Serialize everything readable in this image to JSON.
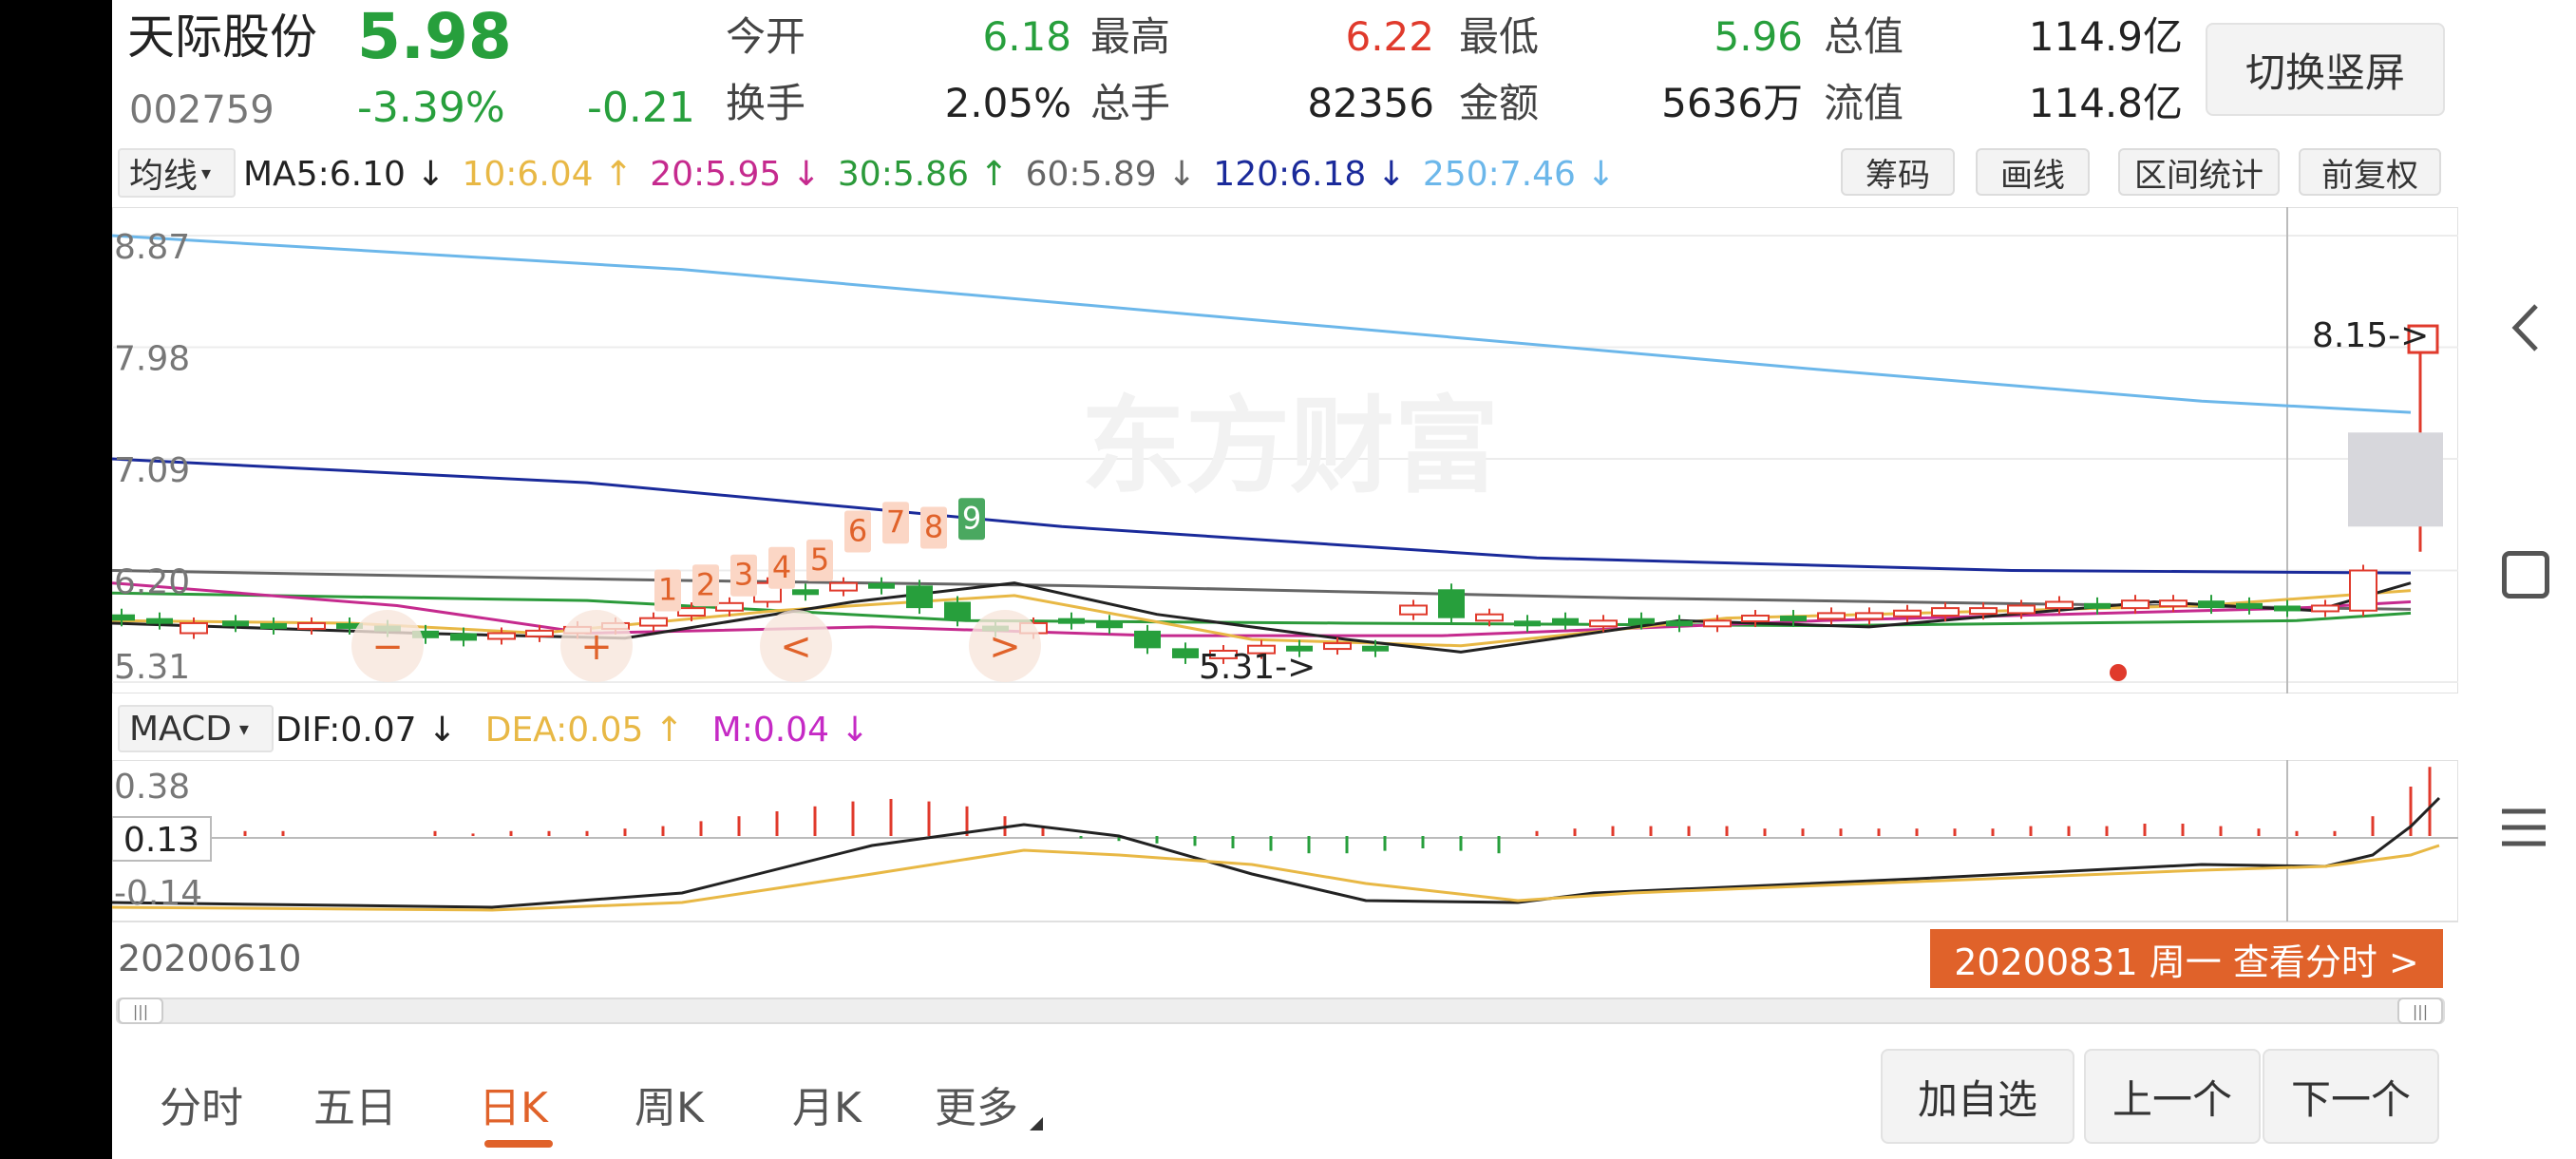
{
  "header": {
    "stock_name": "天际股份",
    "price": "5.98",
    "code": "002759",
    "change_pct": "-3.39%",
    "change_amt": "-0.21",
    "stats": [
      {
        "label": "今开",
        "value": "6.18",
        "color": "green"
      },
      {
        "label": "最高",
        "value": "6.22",
        "color": "red"
      },
      {
        "label": "最低",
        "value": "5.96",
        "color": "green"
      },
      {
        "label": "总值",
        "value": "114.9亿",
        "color": "black"
      },
      {
        "label": "换手",
        "value": "2.05%",
        "color": "black"
      },
      {
        "label": "总手",
        "value": "82356",
        "color": "black"
      },
      {
        "label": "金额",
        "value": "5636万",
        "color": "black"
      },
      {
        "label": "流值",
        "value": "114.8亿",
        "color": "black"
      }
    ],
    "switch_label": "切换竖屏"
  },
  "ma_bar": {
    "selector": "均线",
    "items": [
      {
        "text": "MA5:6.10",
        "arrow": "↓",
        "color": "#222222"
      },
      {
        "text": "10:6.04",
        "arrow": "↑",
        "color": "#e8b845"
      },
      {
        "text": "20:5.95",
        "arrow": "↓",
        "color": "#c52a8e"
      },
      {
        "text": "30:5.86",
        "arrow": "↑",
        "color": "#2b9a3a"
      },
      {
        "text": "60:5.89",
        "arrow": "↓",
        "color": "#666666"
      },
      {
        "text": "120:6.18",
        "arrow": "↓",
        "color": "#1a2a9a"
      },
      {
        "text": "250:7.46",
        "arrow": "↓",
        "color": "#6cb7ea"
      }
    ],
    "buttons": [
      "筹码",
      "画线",
      "区间统计",
      "前复权"
    ]
  },
  "kline": {
    "y_labels": [
      "8.87",
      "7.98",
      "7.09",
      "6.20",
      "5.31"
    ],
    "watermark": "东方财富",
    "max_label": "8.15",
    "min_label": "5.31",
    "td_counts": [
      "1",
      "2",
      "3",
      "4",
      "5",
      "6",
      "7",
      "8",
      "9"
    ]
  },
  "macd_bar": {
    "selector": "MACD",
    "dif": "DIF:0.07",
    "dif_arrow": "↓",
    "dea": "DEA:0.05",
    "dea_arrow": "↑",
    "m": "M:0.04",
    "m_arrow": "↓"
  },
  "macd": {
    "y_labels": [
      "0.38",
      "0.13",
      "-0.14"
    ]
  },
  "date_start": "20200610",
  "date_tip": "20200831 周一  查看分时 >",
  "tabs": [
    "分时",
    "五日",
    "日K",
    "周K",
    "月K",
    "更多"
  ],
  "active_tab": "日K",
  "bottom_buttons": [
    "加自选",
    "上一个",
    "下一个"
  ],
  "nav_icons": [
    "back-icon",
    "home-icon",
    "menu-icon"
  ],
  "colors": {
    "up_red": "#e03a2c",
    "down_green": "#279f3c",
    "accent_orange": "#e0622a"
  },
  "chart_data": {
    "type": "candlestick",
    "ylim": [
      5.31,
      8.87
    ],
    "ma_lines": {
      "ma250": {
        "start": 8.87,
        "end": 7.46
      },
      "ma120": {
        "start": 7.09,
        "end": 6.18
      }
    }
  }
}
